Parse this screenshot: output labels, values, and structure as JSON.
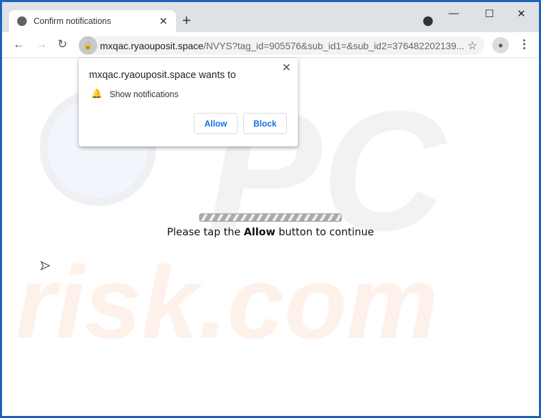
{
  "browser": {
    "tab_title": "Confirm notifications",
    "url_domain": "mxqac.ryaouposit.space",
    "url_path": "/NVYS?tag_id=905576&sub_id1=&sub_id2=376482202139..."
  },
  "popup": {
    "heading": "mxqac.ryaouposit.space wants to",
    "permission": "Show notifications",
    "allow_label": "Allow",
    "block_label": "Block"
  },
  "page": {
    "msg_pre": "Please tap the ",
    "msg_bold": "Allow",
    "msg_post": " button to continue"
  },
  "watermark": {
    "text1": "PC",
    "text2": "risk.com"
  },
  "colors": {
    "accent": "#1a73e8",
    "frame": "#1a63b8"
  }
}
